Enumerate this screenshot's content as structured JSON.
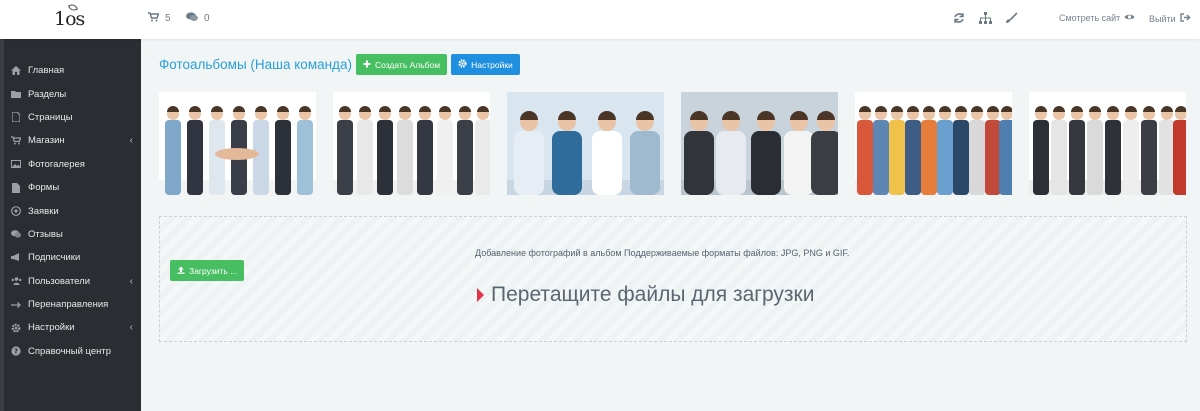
{
  "brand": {
    "logo_text": "1os"
  },
  "topbar": {
    "cart_count": "5",
    "comments_count": "0",
    "view_site_label": "Смотреть сайт",
    "logout_label": "Выйти"
  },
  "sidebar": {
    "items": [
      {
        "label": "Главная",
        "icon": "home-icon",
        "submenu": false
      },
      {
        "label": "Разделы",
        "icon": "folder-icon",
        "submenu": false
      },
      {
        "label": "Страницы",
        "icon": "file-icon",
        "submenu": false
      },
      {
        "label": "Магазин",
        "icon": "cart-icon",
        "submenu": true
      },
      {
        "label": "Фотогалерея",
        "icon": "picture-icon",
        "submenu": false
      },
      {
        "label": "Формы",
        "icon": "form-icon",
        "submenu": false
      },
      {
        "label": "Заявки",
        "icon": "inbox-icon",
        "submenu": false
      },
      {
        "label": "Отзывы",
        "icon": "comments-icon",
        "submenu": false
      },
      {
        "label": "Подписчики",
        "icon": "bullhorn-icon",
        "submenu": false
      },
      {
        "label": "Пользователи",
        "icon": "users-icon",
        "submenu": true
      },
      {
        "label": "Перенаправления",
        "icon": "redirect-icon",
        "submenu": false
      },
      {
        "label": "Настройки",
        "icon": "gear-icon",
        "submenu": true
      },
      {
        "label": "Справочный центр",
        "icon": "help-icon",
        "submenu": false
      }
    ]
  },
  "main": {
    "title": "Фотоальбомы (Наша команда)",
    "create_album_label": "Создать Альбом",
    "settings_label": "Настройки",
    "photos": [
      {
        "name": "team-hands-photo"
      },
      {
        "name": "team-cheering-photo"
      },
      {
        "name": "team-smiling-photo"
      },
      {
        "name": "team-high-five-photo"
      },
      {
        "name": "crowd-jumping-photo"
      },
      {
        "name": "office-team-photo"
      }
    ],
    "dropzone": {
      "upload_label": "Загрузить ...",
      "info": "Добавление фотографий в альбом Поддерживаемые форматы файлов: JPG, PNG и GIF.",
      "drop_text": "Перетащите файлы для загрузки"
    }
  },
  "colors": {
    "accent_blue": "#2a9fd8",
    "button_green": "#46be61",
    "button_blue": "#1f8fe0",
    "sidebar_bg": "#2a2e32",
    "drop_arrow": "#e0354a"
  }
}
